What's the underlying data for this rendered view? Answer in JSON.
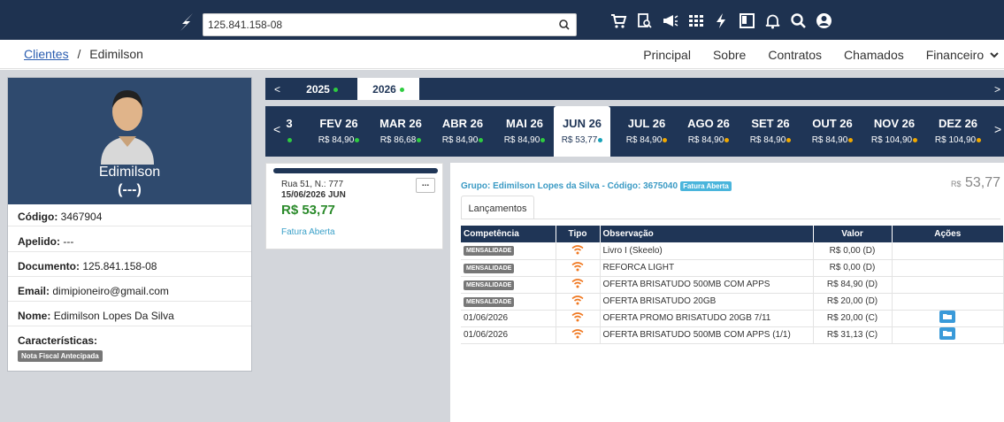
{
  "search": {
    "value": "125.841.158-08"
  },
  "breadcrumb": {
    "root": "Clientes",
    "sep": "/",
    "current": "Edimilson"
  },
  "nav": [
    "Principal",
    "Sobre",
    "Contratos",
    "Chamados",
    "Financeiro"
  ],
  "profile": {
    "name": "Edimilson",
    "nickname_display": "(---)",
    "codigo_label": "Código:",
    "codigo": "3467904",
    "apelido_label": "Apelido:",
    "apelido": "---",
    "documento_label": "Documento:",
    "documento": "125.841.158-08",
    "email_label": "Email:",
    "email": "dimipioneiro@gmail.com",
    "nome_label": "Nome:",
    "nome": "Edimilson Lopes Da Silva",
    "carac_label": "Características:",
    "carac_badge": "Nota Fiscal Antecipada"
  },
  "years": {
    "prev_arrow": "<",
    "next_arrow": ">",
    "y1": "2025",
    "y2": "2026"
  },
  "months": {
    "prev_arrow": "<",
    "next_arrow": ">",
    "partial": "3",
    "items": [
      {
        "name": "FEV 26",
        "value": "R$ 84,90",
        "dot": "#2ecc40"
      },
      {
        "name": "MAR 26",
        "value": "R$ 86,68",
        "dot": "#2ecc40"
      },
      {
        "name": "ABR 26",
        "value": "R$ 84,90",
        "dot": "#2ecc40"
      },
      {
        "name": "MAI 26",
        "value": "R$ 84,90",
        "dot": "#2ecc40"
      },
      {
        "name": "JUN 26",
        "value": "R$ 53,77",
        "dot": "#17a2b8"
      },
      {
        "name": "JUL 26",
        "value": "R$ 84,90",
        "dot": "#f0a800"
      },
      {
        "name": "AGO 26",
        "value": "R$ 84,90",
        "dot": "#f0a800"
      },
      {
        "name": "SET 26",
        "value": "R$ 84,90",
        "dot": "#f0a800"
      },
      {
        "name": "OUT 26",
        "value": "R$ 84,90",
        "dot": "#f0a800"
      },
      {
        "name": "NOV 26",
        "value": "R$ 104,90",
        "dot": "#f0a800"
      },
      {
        "name": "DEZ 26",
        "value": "R$ 104,90",
        "dot": "#f0a800"
      }
    ]
  },
  "invoice": {
    "address": "Rua 51, N.: 777",
    "date": "15/06/2026 JUN",
    "amount": "R$ 53,77",
    "status": "Fatura Aberta",
    "more": "..."
  },
  "detail": {
    "group": "Grupo: Edimilson Lopes da Silva - Código: 3675040",
    "group_badge": "Fatura Aberta",
    "total_prefix": "R$",
    "total": "53,77",
    "tab": "Lançamentos"
  },
  "table": {
    "headers": [
      "Competência",
      "Tipo",
      "Observação",
      "Valor",
      "Ações"
    ],
    "rows": [
      {
        "comp": "MENSALIDADE",
        "badge": true,
        "obs": "Livro I (Skeelo)",
        "valor": "R$ 0,00 (D)",
        "kind": "d",
        "action": false
      },
      {
        "comp": "MENSALIDADE",
        "badge": true,
        "obs": "REFORCA LIGHT",
        "valor": "R$ 0,00 (D)",
        "kind": "d",
        "action": false
      },
      {
        "comp": "MENSALIDADE",
        "badge": true,
        "obs": "OFERTA BRISATUDO 500MB COM APPS",
        "valor": "R$ 84,90 (D)",
        "kind": "d",
        "action": false
      },
      {
        "comp": "MENSALIDADE",
        "badge": true,
        "obs": "OFERTA BRISATUDO 20GB",
        "valor": "R$ 20,00 (D)",
        "kind": "d",
        "action": false
      },
      {
        "comp": "01/06/2026",
        "badge": false,
        "obs": "OFERTA PROMO BRISATUDO 20GB 7/11",
        "valor": "R$ 20,00 (C)",
        "kind": "c",
        "action": true
      },
      {
        "comp": "01/06/2026",
        "badge": false,
        "obs": "OFERTA BRISATUDO 500MB COM APPS (1/1)",
        "valor": "R$ 31,13 (C)",
        "kind": "c",
        "action": true
      }
    ]
  },
  "colors": {
    "navy": "#1f3556",
    "wifi": "#f07820",
    "green": "#2a8a2a",
    "red": "#d9534f"
  }
}
